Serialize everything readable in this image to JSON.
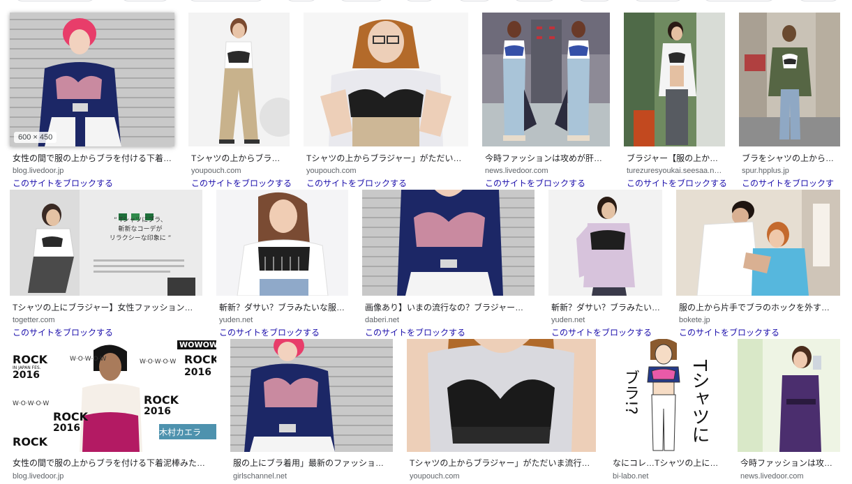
{
  "results": {
    "row1": [
      {
        "caption": "女性の間で服の上からブラを付ける下着…",
        "domain": "blog.livedoor.jp",
        "block_label": "このサイトをブロックする",
        "dims": "600 × 450"
      },
      {
        "caption": "Tシャツの上からブラ…",
        "domain": "youpouch.com",
        "block_label": "このサイトをブロックする"
      },
      {
        "caption": "Tシャツの上からブラジャー」がただい…",
        "domain": "youpouch.com",
        "block_label": "このサイトをブロックする"
      },
      {
        "caption": "今時ファッションは攻めが肝…",
        "domain": "news.livedoor.com",
        "block_label": "このサイトをブロックする"
      },
      {
        "caption": "ブラジャー【服の上か…",
        "domain": "turezuresyoukai.seesaa.n…",
        "block_label": "このサイトをブロックする"
      },
      {
        "caption": "ブラをシャツの上から…",
        "domain": "spur.hpplus.jp",
        "block_label": "このサイトをブロックす"
      }
    ],
    "row2": [
      {
        "caption": "Tシャツの上にブラジャー】女性ファッション…",
        "domain": "togetter.com",
        "block_label": "このサイトをブロックする"
      },
      {
        "caption": "斬新？ダサい？ブラみたいな服…",
        "domain": "yuden.net",
        "block_label": "このサイトをブロックする"
      },
      {
        "caption": "画像あり】いまの流行なの？ブラジャー…",
        "domain": "daberi.net",
        "block_label": "このサイトをブロックする"
      },
      {
        "caption": "斬新？ダサい？ブラみたい…",
        "domain": "yuden.net",
        "block_label": "このサイトをブロックする"
      },
      {
        "caption": "服の上から片手でブラのホックを外す…",
        "domain": "bokete.jp",
        "block_label": "このサイトをブロックする"
      }
    ],
    "row3": [
      {
        "caption": "女性の間で服の上からブラを付ける下着泥棒みた…",
        "domain": "blog.livedoor.jp"
      },
      {
        "caption": "服の上にブラ着用」最新のファッショ…",
        "domain": "girlschannel.net"
      },
      {
        "caption": "Tシャツの上からブラジャー」がただいま流行…",
        "domain": "youpouch.com"
      },
      {
        "caption": "なにコレ…Tシャツの上に…",
        "domain": "bi-labo.net"
      },
      {
        "caption": "今時ファッションは攻…",
        "domain": "news.livedoor.com"
      }
    ]
  },
  "image_text": {
    "poster_quote": "“ Tシャツにブラ、",
    "poster_line2": "斬新なコーデが",
    "poster_line3": "リラクシーな印象に ”",
    "wowow_logo": "WOWOW",
    "rock_title": "ROCK",
    "rock_sub": "IN JAPAN FES.",
    "rock_year": "2016",
    "wowow_wall": "W·O·W·O·W",
    "name_caption": "木村カエラ",
    "illust_text_t": "Tシャツに",
    "illust_text_bra": "ブラ!?"
  },
  "colors": {
    "link": "#1a0dab",
    "caption": "#202124",
    "domain": "#5f6368"
  }
}
